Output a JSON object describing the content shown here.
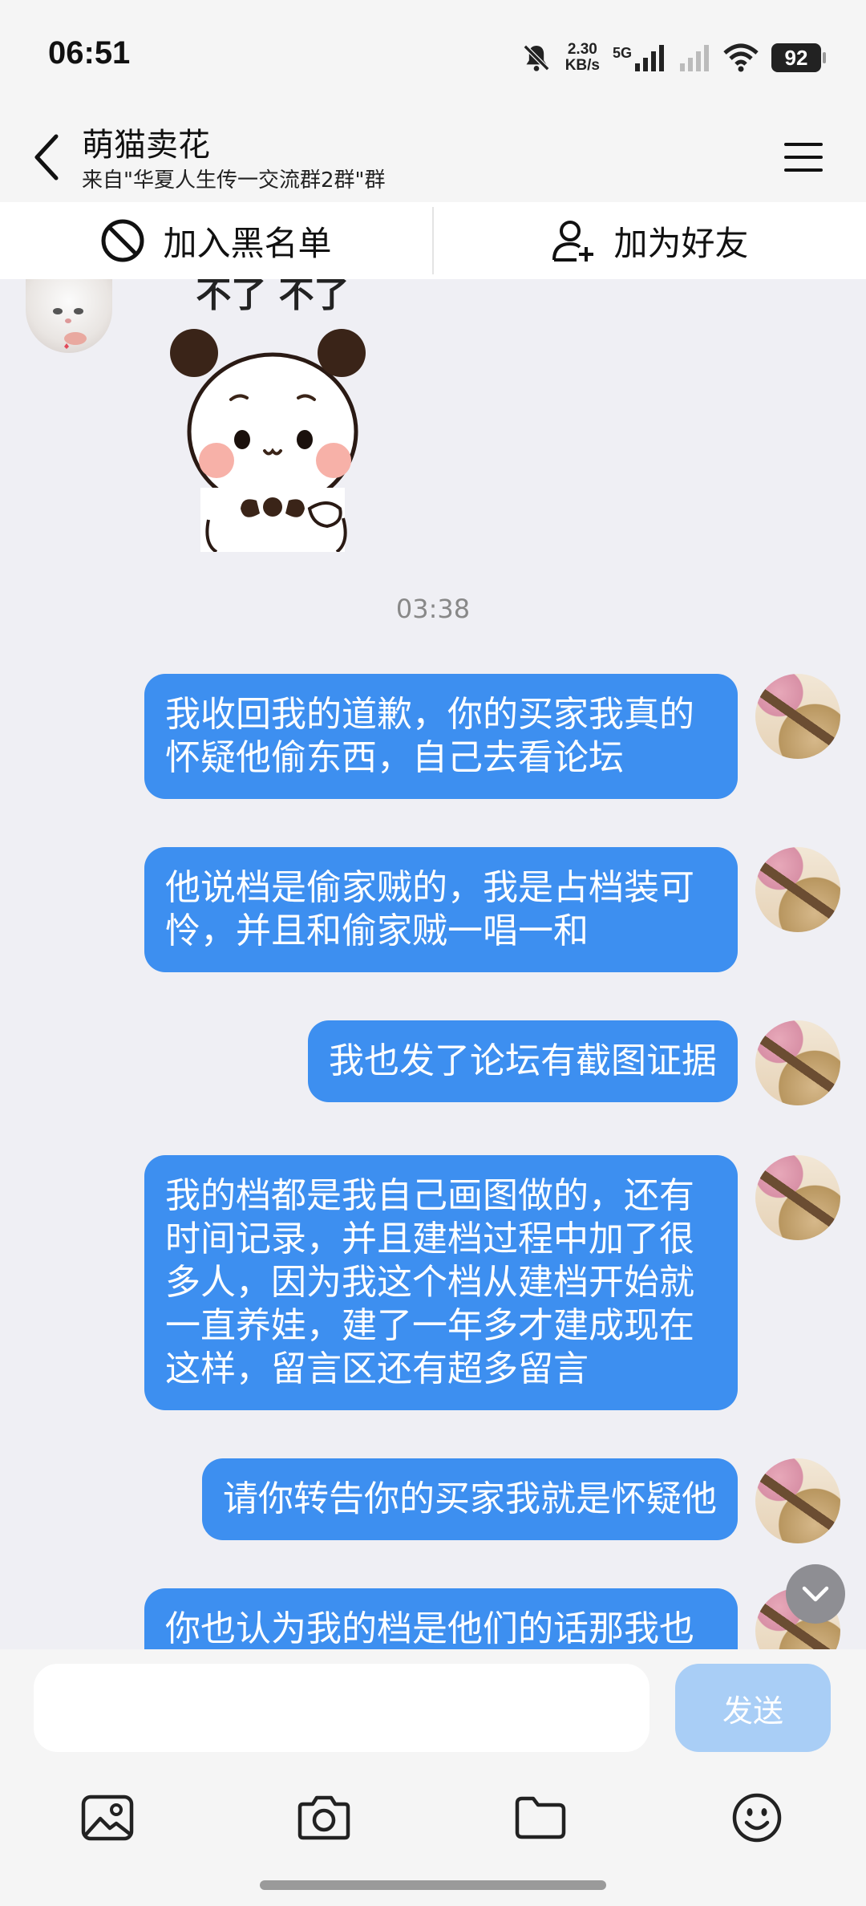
{
  "status_bar": {
    "time": "06:51",
    "net_speed_value": "2.30",
    "net_speed_unit": "KB/s",
    "network_type": "5G",
    "battery": "92",
    "icons": [
      "bell-muted-icon",
      "signal-icon",
      "signal-weak-icon",
      "wifi-icon",
      "battery-icon"
    ]
  },
  "header": {
    "title": "萌猫卖花",
    "subtitle": "来自\"华夏人生传一交流群2群\"群",
    "back_icon": "chevron-left-icon",
    "menu_icon": "hamburger-menu-icon"
  },
  "actions": {
    "blacklist": "加入黑名单",
    "add_friend": "加为好友"
  },
  "sticker": {
    "caption": "不了 不了"
  },
  "chat": {
    "timestamp": "03:38",
    "messages": [
      {
        "line1": "我收回我的道歉，你的买家我真的",
        "line2": "怀疑他偷东西，自己去看论坛"
      },
      {
        "line1": "他说档是偷家贼的，我是占档装可",
        "line2": "怜，并且和偷家贼一唱一和"
      },
      {
        "line1": "我也发了论坛有截图证据"
      },
      {
        "line1": "我的档都是我自己画图做的，还有",
        "line2": "时间记录，并且建档过程中加了很",
        "line3": "多人，因为我这个档从建档开始就",
        "line4": "一直养娃，建了一年多才建成现在",
        "line5": "这样，留言区还有超多留言"
      },
      {
        "line1": "请你转告你的买家我就是怀疑他"
      },
      {
        "line1": "你也认为我的档是他们的话那我也"
      }
    ]
  },
  "input": {
    "placeholder": "",
    "send_label": "发送"
  },
  "colors": {
    "bubble": "#3d8ff0",
    "send_disabled": "#a9cef6",
    "background": "#efeff4"
  }
}
